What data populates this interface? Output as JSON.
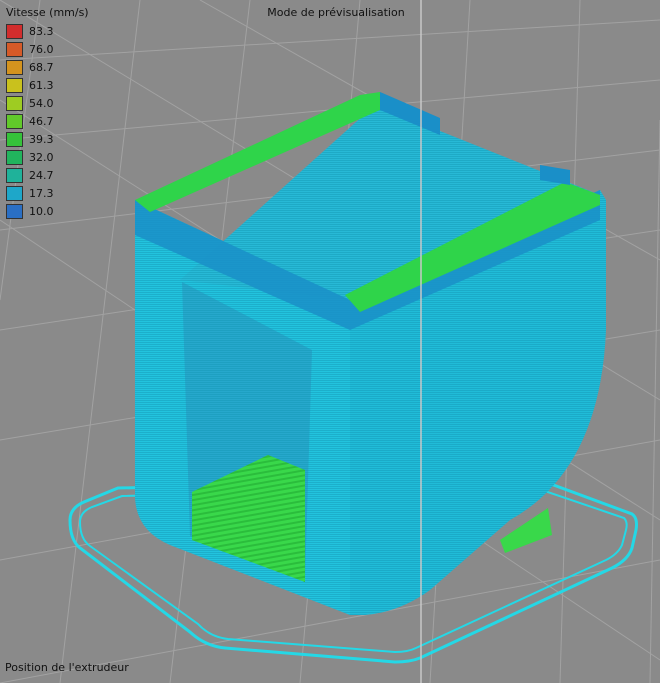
{
  "header": {
    "title": "Mode de prévisualisation"
  },
  "legend": {
    "title": "Vitesse (mm/s)",
    "items": [
      {
        "value": "83.3",
        "color": "#d22d2d"
      },
      {
        "value": "76.0",
        "color": "#d65a28"
      },
      {
        "value": "68.7",
        "color": "#d4931e"
      },
      {
        "value": "61.3",
        "color": "#c9c11d"
      },
      {
        "value": "54.0",
        "color": "#9ecc22"
      },
      {
        "value": "46.7",
        "color": "#61c92a"
      },
      {
        "value": "39.3",
        "color": "#35c23a"
      },
      {
        "value": "32.0",
        "color": "#21b45d"
      },
      {
        "value": "24.7",
        "color": "#1fb29a"
      },
      {
        "value": "17.3",
        "color": "#1ea7c9"
      },
      {
        "value": "10.0",
        "color": "#2a6fc4"
      }
    ]
  },
  "footer": {
    "status": "Position de l'extrudeur"
  },
  "colors": {
    "background": "#8a8a8a",
    "grid": "#a2a2a2",
    "wall": "#22c3de",
    "wall_dark": "#1a8fc8",
    "infill": "#39d84a",
    "skirt": "#24d8e6"
  }
}
